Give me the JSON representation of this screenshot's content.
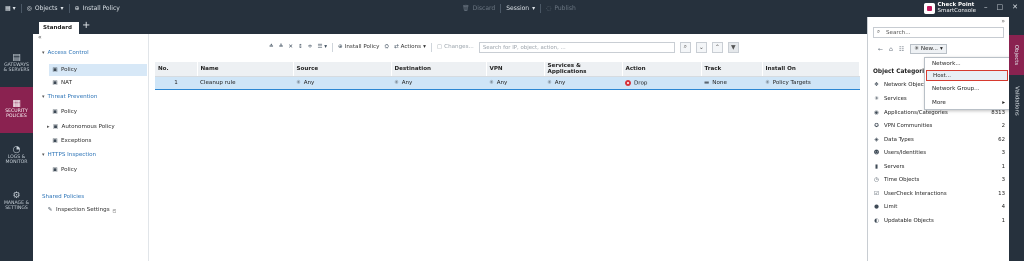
{
  "topbar": {
    "objects_label": "Objects",
    "install_policy_label": "Install Policy",
    "discard_label": "Discard",
    "session_label": "Session",
    "publish_label": "Publish",
    "brand_line1": "Check Point",
    "brand_line2": "SmartConsole"
  },
  "left_nav": [
    {
      "label_1": "GATEWAYS",
      "label_2": "& SERVERS",
      "icon": "gateways-icon"
    },
    {
      "label_1": "SECURITY",
      "label_2": "POLICIES",
      "icon": "security-policies-icon"
    },
    {
      "label_1": "LOGS &",
      "label_2": "MONITOR",
      "icon": "logs-icon"
    },
    {
      "label_1": "MANAGE &",
      "label_2": "SETTINGS",
      "icon": "manage-icon"
    }
  ],
  "tabs": {
    "active": "Standard",
    "add": "+"
  },
  "tree": {
    "access_control": "Access Control",
    "policy": "Policy",
    "nat": "NAT",
    "threat_prevention": "Threat Prevention",
    "tp_policy": "Policy",
    "autonomous_policy": "Autonomous Policy",
    "exceptions": "Exceptions",
    "https_inspection": "HTTPS Inspection",
    "https_policy": "Policy",
    "shared_policies": "Shared Policies",
    "inspection_settings": "Inspection Settings"
  },
  "toolbar": {
    "install_policy": "Install Policy",
    "actions": "Actions",
    "changes": "Changes...",
    "search_placeholder": "Search for IP, object, action, ..."
  },
  "rules_table": {
    "columns": [
      "No.",
      "Name",
      "Source",
      "Destination",
      "VPN",
      "Services & Applications",
      "Action",
      "Track",
      "Install On"
    ],
    "rows": [
      {
        "no": "1",
        "name": "Cleanup rule",
        "source": "Any",
        "destination": "Any",
        "vpn": "Any",
        "services": "Any",
        "action": "Drop",
        "track": "None",
        "install_on": "Policy Targets"
      }
    ]
  },
  "object_panel": {
    "search_placeholder": "Search...",
    "new_label": "New...",
    "heading": "Object Categories",
    "categories": [
      {
        "name": "Network Objects",
        "count": "",
        "icon": "network-objects-icon"
      },
      {
        "name": "Services",
        "count": "",
        "icon": "services-icon"
      },
      {
        "name": "Applications/Categories",
        "count": "8313",
        "icon": "applications-icon"
      },
      {
        "name": "VPN Communities",
        "count": "2",
        "icon": "vpn-icon"
      },
      {
        "name": "Data Types",
        "count": "62",
        "icon": "data-types-icon"
      },
      {
        "name": "Users/Identities",
        "count": "3",
        "icon": "users-icon"
      },
      {
        "name": "Servers",
        "count": "1",
        "icon": "servers-icon"
      },
      {
        "name": "Time Objects",
        "count": "3",
        "icon": "time-icon"
      },
      {
        "name": "UserCheck Interactions",
        "count": "13",
        "icon": "usercheck-icon"
      },
      {
        "name": "Limit",
        "count": "4",
        "icon": "limit-icon"
      },
      {
        "name": "Updatable Objects",
        "count": "1",
        "icon": "updatable-icon"
      }
    ]
  },
  "new_menu": {
    "items": [
      "Network...",
      "Host...",
      "Network Group...",
      "More"
    ],
    "highlighted": "Host..."
  },
  "right_tabs": {
    "objects": "Objects",
    "validations": "Validations"
  },
  "colors": {
    "accent": "#8a2250",
    "selection": "#cfe5f7",
    "highlight_border": "#d63a2f"
  }
}
